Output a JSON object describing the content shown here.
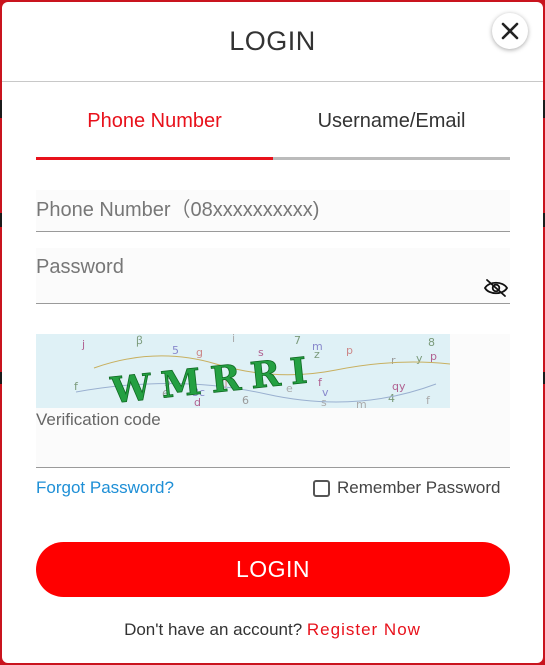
{
  "modal": {
    "title": "LOGIN",
    "close_icon": "close-icon"
  },
  "tabs": [
    {
      "label": "Phone Number",
      "active": true
    },
    {
      "label": "Username/Email",
      "active": false
    }
  ],
  "form": {
    "phone": {
      "placeholder": "Phone Number（08xxxxxxxxxx)",
      "value": ""
    },
    "password": {
      "placeholder": "Password",
      "value": "",
      "toggle_icon": "eye-slash-icon"
    },
    "captcha": {
      "text": "WMRRI",
      "label": "Verification code"
    },
    "forgot_label": "Forgot Password?",
    "remember_label": "Remember Password",
    "remember_checked": false,
    "submit_label": "LOGIN"
  },
  "footer": {
    "prompt": "Don't have an account?",
    "register_label": "Register Now"
  },
  "colors": {
    "accent": "#e8111b",
    "button": "#ff0000",
    "link": "#1e8fd6",
    "captcha_bg": "#dff1f6"
  }
}
